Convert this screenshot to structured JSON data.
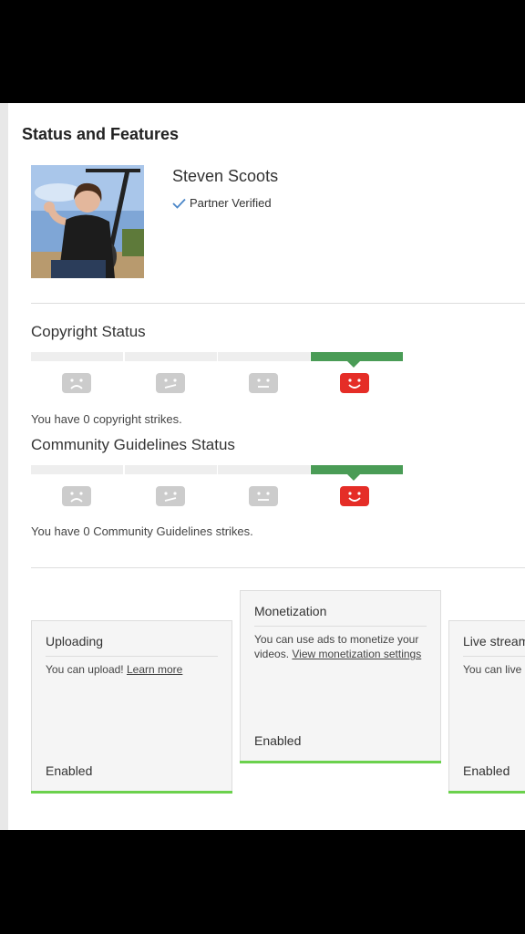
{
  "page": {
    "title": "Status and Features"
  },
  "channel": {
    "name": "Steven Scoots",
    "badge": "Partner Verified"
  },
  "copyright": {
    "title": "Copyright Status",
    "strikes_text": "You have 0 copyright strikes.",
    "level": 4,
    "levels_total": 4
  },
  "community": {
    "title": "Community Guidelines Status",
    "strikes_text": "You have 0 Community Guidelines strikes.",
    "level": 4,
    "levels_total": 4
  },
  "colors": {
    "active_segment": "#4a9c56",
    "inactive_segment": "#eeeeee",
    "happy_face": "#e52d27",
    "inactive_face": "#cccccc",
    "enabled_bar": "#6bd14d"
  },
  "icons": [
    "check-icon",
    "sad-face-icon",
    "meh-face-icon",
    "neutral-face-icon",
    "happy-face-icon"
  ],
  "cards": {
    "uploading": {
      "title": "Uploading",
      "desc": "You can upload!",
      "link": "Learn more",
      "status": "Enabled"
    },
    "monetization": {
      "title": "Monetization",
      "desc": "You can use ads to monetize your videos.",
      "link": "View monetization settings",
      "status": "Enabled"
    },
    "live": {
      "title": "Live streaming",
      "desc": "You can live stream!",
      "status": "Enabled"
    }
  }
}
